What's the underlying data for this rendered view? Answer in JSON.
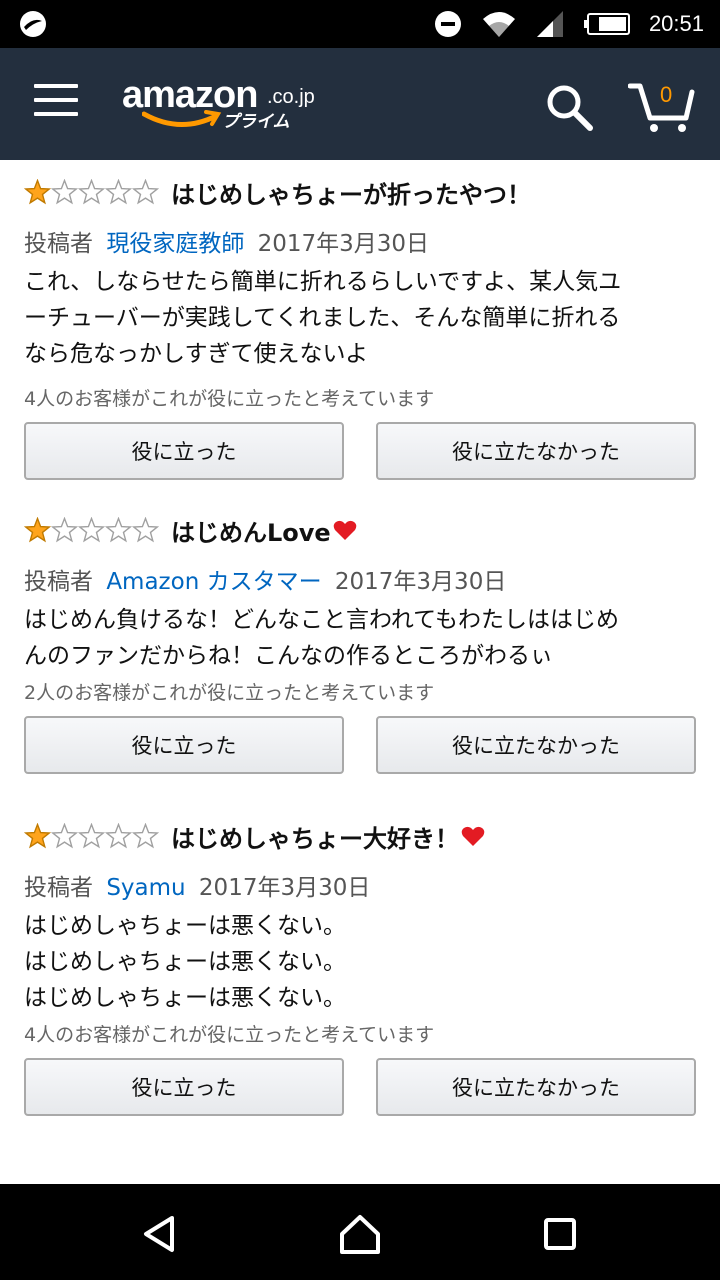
{
  "status_bar": {
    "time": "20:51",
    "icons": [
      "notification-icon",
      "do-not-disturb-icon",
      "wifi-icon",
      "signal-icon",
      "battery-icon"
    ]
  },
  "header": {
    "logo_text": "amazon",
    "logo_tld": ".co.jp",
    "logo_sub": "プライム",
    "cart_count": "0",
    "icons": [
      "menu-icon",
      "search-icon",
      "cart-icon"
    ],
    "colors": {
      "bar": "#232f3e",
      "accent": "#ff9900"
    }
  },
  "reviews": [
    {
      "rating": 1,
      "title": "はじめしゃちょーが折ったやつ！",
      "heart": false,
      "byline_prefix": "投稿者",
      "author": "現役家庭教師",
      "date": "2017年3月30日",
      "body_lines": [
        "これ、しならせたら簡単に折れるらしいですよ、某人気ユ",
        "ーチューバーが実践してくれました、そんな簡単に折れる",
        "なら危なっかしすぎて使えないよ"
      ],
      "helpful_text": "4人のお客様がこれが役に立ったと考えています",
      "yes_label": "役に立った",
      "no_label": "役に立たなかった"
    },
    {
      "rating": 1,
      "title": "はじめんLove",
      "heart": true,
      "byline_prefix": "投稿者",
      "author": "Amazon カスタマー",
      "date": "2017年3月30日",
      "body_lines": [
        "はじめん負けるな！どんなこと言われてもわたしははじめ",
        "んのファンだからね！こんなの作るところがわるぃ"
      ],
      "helpful_text": "2人のお客様がこれが役に立ったと考えています",
      "yes_label": "役に立った",
      "no_label": "役に立たなかった"
    },
    {
      "rating": 1,
      "title": "はじめしゃちょー大好き！",
      "heart": true,
      "byline_prefix": "投稿者",
      "author": "Syamu",
      "date": "2017年3月30日",
      "body_lines": [
        "はじめしゃちょーは悪くない。",
        "はじめしゃちょーは悪くない。",
        "はじめしゃちょーは悪くない。"
      ],
      "helpful_text": "4人のお客様がこれが役に立ったと考えています",
      "yes_label": "役に立った",
      "no_label": "役に立たなかった"
    }
  ],
  "colors": {
    "star_filled": "#ffa41c",
    "author_link": "#0066c0",
    "heart": "#e31b23"
  },
  "nav_bar": {
    "icons": [
      "back-icon",
      "home-icon",
      "recents-icon"
    ]
  }
}
